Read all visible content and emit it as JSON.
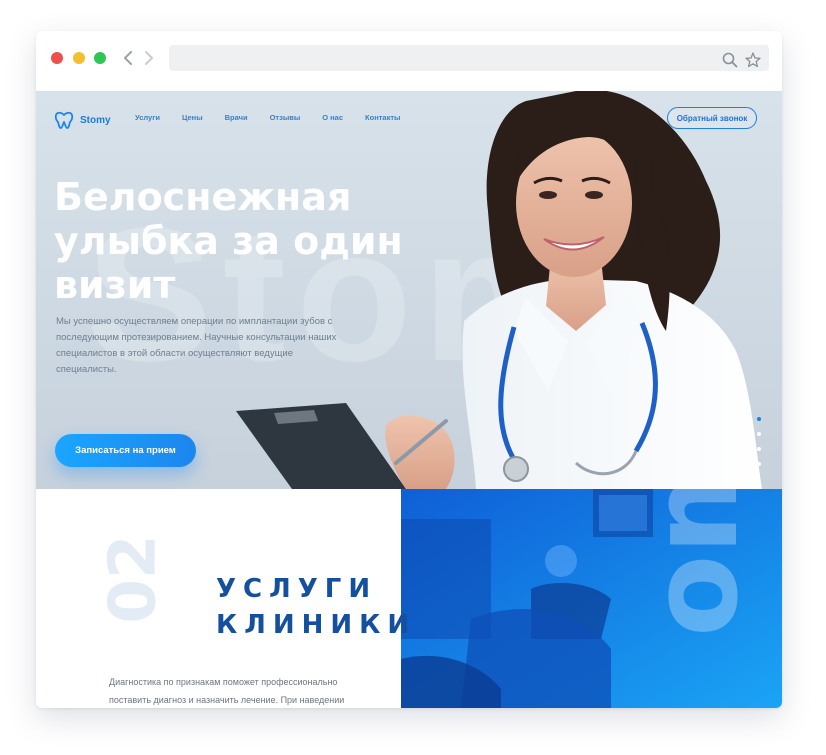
{
  "hero": {
    "brand": "Stomy",
    "nav": [
      "Услуги",
      "Цены",
      "Врачи",
      "Отзывы",
      "О нас",
      "Контакты"
    ],
    "callback_label": "Обратный звонок",
    "headline": [
      "Белоснежная",
      "улыбка за один",
      "визит"
    ],
    "subtext": "Мы успешно осуществляем операции по имплантации зубов с последующим протезированием. Научные консультации наших специалистов в этой области осуществляют ведущие специалисты.",
    "cta_label": "Записаться на прием",
    "watermark": "Stomy",
    "slider": {
      "count": 4,
      "active": 1
    }
  },
  "services": {
    "number": "02",
    "title": [
      "услуги",
      "клиники"
    ],
    "text": "Диагностика по признакам поможет профессионально поставить диагноз и назначить лечение. При наведении",
    "photo_watermark": "om"
  },
  "colors": {
    "accent": "#1c86ee",
    "title_blue": "#14509e",
    "hero_bg": "#d3dde6",
    "photo_overlay": "#1873e0"
  },
  "icons": [
    "back-arrow-icon",
    "forward-arrow-icon",
    "search-icon",
    "star-icon",
    "tooth-logo-icon"
  ]
}
